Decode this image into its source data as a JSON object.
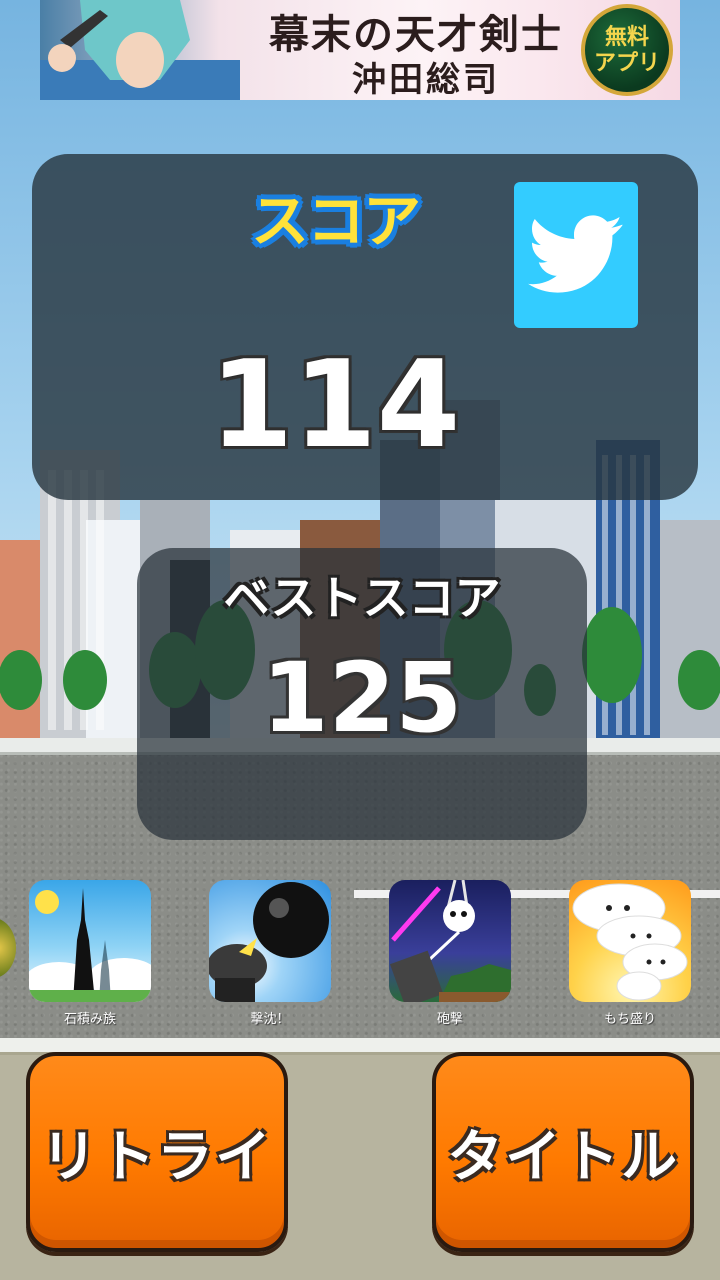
{
  "ad": {
    "title": "幕末の天才剣士",
    "subtitle": "沖田総司",
    "badge_line1": "無料",
    "badge_line2": "アプリ"
  },
  "score": {
    "label": "スコア",
    "value": "114",
    "share_icon": "twitter-bird-icon",
    "share_color": "#33ccff"
  },
  "best": {
    "label": "ベストスコア",
    "value": "125"
  },
  "apps": [
    {
      "name": "石積み族",
      "icon": "tower-app-icon"
    },
    {
      "name": "撃沈！",
      "icon": "cannonball-app-icon"
    },
    {
      "name": "砲撃",
      "icon": "cannon-night-app-icon"
    },
    {
      "name": "もち盛り",
      "icon": "mochi-app-icon"
    }
  ],
  "buttons": {
    "retry": "リトライ",
    "title": "タイトル",
    "color": "#ff7a00"
  }
}
